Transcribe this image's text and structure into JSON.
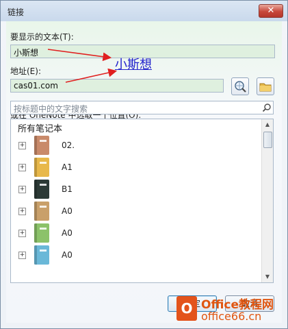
{
  "window": {
    "title": "链接",
    "close_glyph": "✕"
  },
  "display_text": {
    "label": "要显示的文本(T):",
    "value": "小斯想"
  },
  "address": {
    "label": "地址(E):",
    "value": "cas01.com",
    "browse_web_icon": "globe-search-icon",
    "browse_file_icon": "folder-icon"
  },
  "onenote_pick": {
    "label": "或在 OneNote 中选取一个位置(O):",
    "search_placeholder": "按标题中的文字搜索",
    "search_icon": "magnifier-icon"
  },
  "tree": {
    "header": "所有笔记本",
    "items": [
      {
        "name": "02.",
        "color": "#c98a6a"
      },
      {
        "name": "A1",
        "color": "#e8b84a"
      },
      {
        "name": "B1",
        "color": "#2c3a36"
      },
      {
        "name": "A0",
        "color": "#c9a06a"
      },
      {
        "name": "A0",
        "color": "#8cc26a"
      },
      {
        "name": "A0",
        "color": "#6ab8d8"
      }
    ],
    "expander_glyph": "+"
  },
  "buttons": {
    "ok": "确定",
    "cancel": "取消"
  },
  "annotation": {
    "text": "小斯想",
    "color": "#2222cc"
  },
  "watermark": {
    "brand": "Office教程网",
    "url": "office66.cn",
    "logo_glyph": "O"
  }
}
